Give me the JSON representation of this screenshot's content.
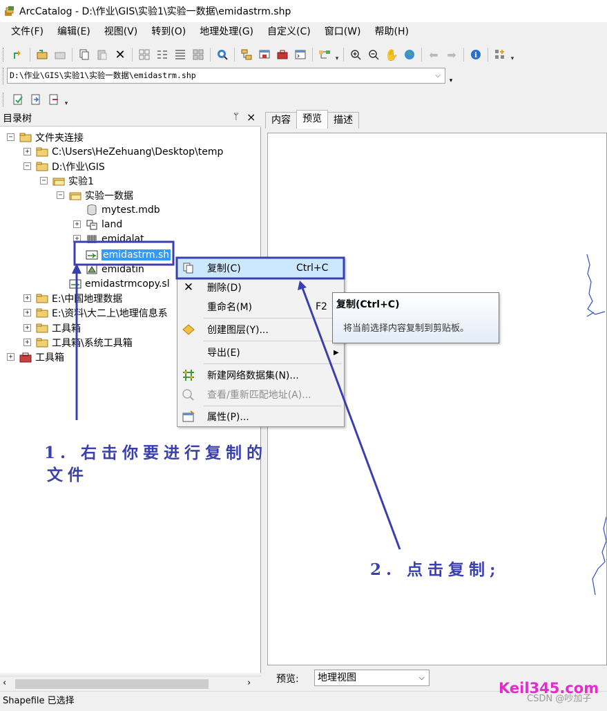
{
  "window": {
    "title": "ArcCatalog - D:\\作业\\GIS\\实验1\\实验一数据\\emidastrm.shp"
  },
  "menubar": {
    "items": [
      "文件(F)",
      "编辑(E)",
      "视图(V)",
      "转到(O)",
      "地理处理(G)",
      "自定义(C)",
      "窗口(W)",
      "帮助(H)"
    ]
  },
  "location": {
    "value": "D:\\作业\\GIS\\实验1\\实验一数据\\emidastrm.shp"
  },
  "tree_pane": {
    "title": "目录树",
    "pin": "ᛘ",
    "close": "×",
    "nodes": [
      {
        "label": "文件夹连接",
        "expander": "⊟"
      },
      {
        "label": "C:\\Users\\HeZehuang\\Desktop\\temp",
        "expander": "+"
      },
      {
        "label": "D:\\作业\\GIS",
        "expander": "−"
      },
      {
        "label": "实验1",
        "expander": "−"
      },
      {
        "label": "实验一数据",
        "expander": "−"
      },
      {
        "label": "mytest.mdb",
        "expander": ""
      },
      {
        "label": "land",
        "expander": "+"
      },
      {
        "label": "emidalat",
        "expander": "+"
      },
      {
        "label": "emidastrm.sh",
        "expander": ""
      },
      {
        "label": "emidatin",
        "expander": ""
      },
      {
        "label": "emidastrmcopy.sl",
        "expander": ""
      },
      {
        "label": "E:\\中国地理数据",
        "expander": "+"
      },
      {
        "label": "E:\\资料\\大二上\\地理信息系",
        "expander": "+"
      },
      {
        "label": "工具箱",
        "expander": "+"
      },
      {
        "label": "工具箱\\系统工具箱",
        "expander": "+"
      },
      {
        "label": "工具箱",
        "expander": "+"
      }
    ]
  },
  "tabs": [
    {
      "label": "内容"
    },
    {
      "label": "预览"
    },
    {
      "label": "描述"
    }
  ],
  "preview": {
    "label": "预览:",
    "selected": "地理视图"
  },
  "context_menu": {
    "items": [
      {
        "label": "复制(C)",
        "shortcut": "Ctrl+C"
      },
      {
        "label": "删除(D)",
        "shortcut": ""
      },
      {
        "label": "重命名(M)",
        "shortcut": "F2"
      },
      {
        "label": "创建图层(Y)...",
        "shortcut": ""
      },
      {
        "label": "导出(E)",
        "shortcut": ""
      },
      {
        "label": "新建网络数据集(N)...",
        "shortcut": ""
      },
      {
        "label": "查看/重新匹配地址(A)...",
        "shortcut": ""
      },
      {
        "label": "属性(P)...",
        "shortcut": ""
      }
    ]
  },
  "tooltip": {
    "title": "复制(Ctrl+C)",
    "body": "将当前选择内容复制到剪贴板。"
  },
  "annotations": {
    "step1_line1": "1. 右击你要进行复制的",
    "step1_line2": "文件",
    "step2": "2. 点击复制;",
    "accent_color": "#3a3fb0"
  },
  "watermark": {
    "main": "Keil345.com",
    "sub": "CSDN @吵加子"
  },
  "statusbar": {
    "text": "Shapefile 已选择"
  }
}
